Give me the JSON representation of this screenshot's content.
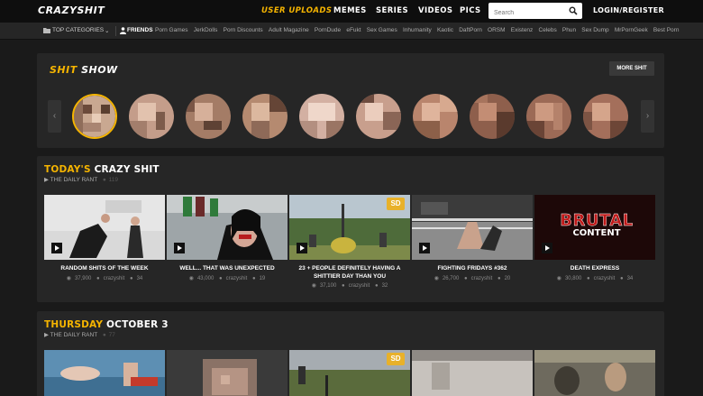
{
  "header": {
    "logo": "CRAZYSHIT",
    "nav": {
      "user_uploads": "USER UPLOADS",
      "memes": "MEMES",
      "series": "SERIES",
      "videos": "VIDEOS",
      "pics": "PICS"
    },
    "search_placeholder": "Search",
    "login": "LOGIN/REGISTER"
  },
  "subnav": {
    "top_categories": "TOP CATEGORIES",
    "friends": "FRIENDS",
    "links": [
      "Porn Games",
      "JerkDolls",
      "Porn Discounts",
      "Adult Magazine",
      "PornDude",
      "eFukt",
      "Sex Games",
      "Inhumanity",
      "Kaotic",
      "DaftPorn",
      "ORSM",
      "Existenz",
      "Celebs",
      "Phun",
      "Sex Dump",
      "MrPornGeek",
      "Best Porn"
    ]
  },
  "shit_show": {
    "title_yellow": "SHIT",
    "title_white": "SHOW",
    "more_button": "MORE SHIT",
    "prev_arrow": "‹",
    "next_arrow": "›"
  },
  "sections": [
    {
      "title_yellow": "TODAY'S",
      "title_white": "CRAZY SHIT",
      "subtitle": "▶ THE DAILY RANT",
      "count": "119",
      "videos": [
        {
          "title": "RANDOM SHITS OF THE WEEK",
          "views": "37,900",
          "author": "crazyshit",
          "comments": "34"
        },
        {
          "title": "WELL... THAT WAS UNEXPECTED",
          "views": "43,000",
          "author": "crazyshit",
          "comments": "19"
        },
        {
          "title": "23 + PEOPLE DEFINITELY HAVING A SHITTIER DAY THAN YOU",
          "views": "37,100",
          "author": "crazyshit",
          "comments": "32",
          "badge": "SD"
        },
        {
          "title": "FIGHTING FRIDAYS #362",
          "views": "26,700",
          "author": "crazyshit",
          "comments": "20"
        },
        {
          "title": "DEATH EXPRESS",
          "views": "30,800",
          "author": "crazyshit",
          "comments": "34",
          "overlay_line1": "BRUTAL",
          "overlay_line2": "CONTENT"
        }
      ]
    },
    {
      "title_yellow": "THURSDAY",
      "title_white": "OCTOBER 3",
      "subtitle": "▶ THE DAILY RANT",
      "count": "77",
      "thumb_badge": "SD"
    }
  ],
  "colors": {
    "accent": "#f5b400",
    "topbar": "#0e0e0e",
    "panel": "#262626",
    "background": "#1a1a1a"
  }
}
